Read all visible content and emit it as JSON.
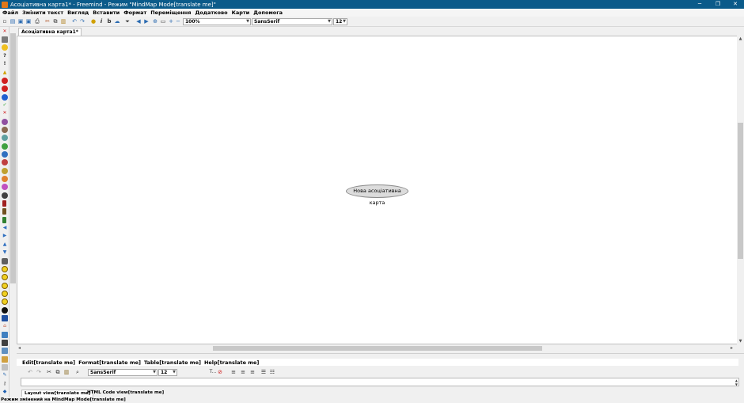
{
  "window": {
    "title": "Асоціативна карта1* - Freemind - Режим \"MindMap Mode[translate me]\"",
    "minimize": "─",
    "maximize": "❐",
    "close": "✕"
  },
  "menubar": {
    "items": [
      "Файл",
      "Змінити текст",
      "Вигляд",
      "Вставити",
      "Формат",
      "Переміщення",
      "Додатково",
      "Карти",
      "Допомога"
    ]
  },
  "toolbar": {
    "zoom_value": "100%",
    "font_value": "SansSerif",
    "size_value": "12"
  },
  "tabs": {
    "active_tab": "Асоціативна карта1*"
  },
  "mindmap": {
    "root_node": "Нова асоціативна карта",
    "node_color": "#dcdcdc"
  },
  "editor": {
    "menu": [
      "Edit[translate me]",
      "Format[translate me]",
      "Table[translate me]",
      "Help[translate me]"
    ],
    "font_value": "SansSerif",
    "size_value": "12",
    "text_label": "T...",
    "view_tabs": [
      "Layout view[translate me]",
      "HTML Code view[translate me]"
    ]
  },
  "status": {
    "text": "Режим змінений на MindMap Mode[translate me]"
  },
  "colors": {
    "titlebar": "#0b5b8a",
    "canvas": "#ffffff"
  }
}
